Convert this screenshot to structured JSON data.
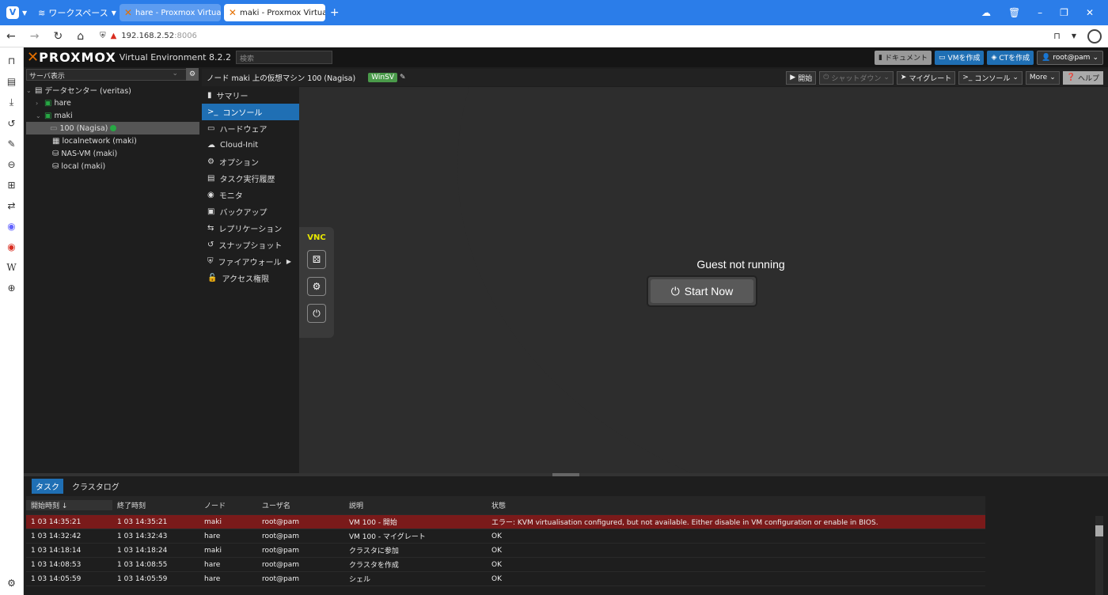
{
  "browser": {
    "workspace": "ワークスペース",
    "tabs": [
      {
        "title": "hare - Proxmox Virtual Env"
      },
      {
        "title": "maki - Proxmox Virtual Env"
      }
    ],
    "url_host": "192.168.2.52",
    "url_port": ":8006"
  },
  "pve": {
    "brand": "PROXMOX",
    "version": "Virtual Environment 8.2.2",
    "search_placeholder": "検索",
    "header_buttons": {
      "docs": "ドキュメント",
      "create_vm": "VMを作成",
      "create_ct": "CTを作成",
      "user": "root@pam"
    },
    "view_selector": "サーバ表示",
    "tree": [
      {
        "label": "データセンター (veritas)"
      },
      {
        "label": "hare"
      },
      {
        "label": "maki"
      },
      {
        "label": "100 (Nagisa)"
      },
      {
        "label": "localnetwork (maki)"
      },
      {
        "label": "NAS-VM (maki)"
      },
      {
        "label": "local (maki)"
      }
    ],
    "content_title": "ノード maki 上の仮想マシン 100 (Nagisa)",
    "tag": "WinSV",
    "toolbar": {
      "start": "開始",
      "shutdown": "シャットダウン",
      "migrate": "マイグレート",
      "console": "コンソール",
      "more": "More",
      "help": "ヘルプ"
    },
    "menu": [
      {
        "label": "サマリー"
      },
      {
        "label": "コンソール"
      },
      {
        "label": "ハードウェア"
      },
      {
        "label": "Cloud-Init"
      },
      {
        "label": "オプション"
      },
      {
        "label": "タスク実行履歴"
      },
      {
        "label": "モニタ"
      },
      {
        "label": "バックアップ"
      },
      {
        "label": "レプリケーション"
      },
      {
        "label": "スナップショット"
      },
      {
        "label": "ファイアウォール"
      },
      {
        "label": "アクセス権限"
      }
    ],
    "console": {
      "vnc_label": "VNC",
      "guest_status": "Guest not running",
      "start_now": "Start Now"
    },
    "bottom": {
      "tabs": [
        "タスク",
        "クラスタログ"
      ],
      "columns": [
        "開始時刻 ↓",
        "終了時刻",
        "ノード",
        "ユーザ名",
        "説明",
        "状態"
      ],
      "rows": [
        {
          "start": "1 03 14:35:21",
          "end": "1 03 14:35:21",
          "node": "maki",
          "user": "root@pam",
          "desc": "VM 100 - 開始",
          "status": "エラー: KVM virtualisation configured, but not available. Either disable in VM configuration or enable in BIOS."
        },
        {
          "start": "1 03 14:32:42",
          "end": "1 03 14:32:43",
          "node": "hare",
          "user": "root@pam",
          "desc": "VM 100 - マイグレート",
          "status": "OK"
        },
        {
          "start": "1 03 14:18:14",
          "end": "1 03 14:18:24",
          "node": "maki",
          "user": "root@pam",
          "desc": "クラスタに参加",
          "status": "OK"
        },
        {
          "start": "1 03 14:08:53",
          "end": "1 03 14:08:55",
          "node": "hare",
          "user": "root@pam",
          "desc": "クラスタを作成",
          "status": "OK"
        },
        {
          "start": "1 03 14:05:59",
          "end": "1 03 14:05:59",
          "node": "hare",
          "user": "root@pam",
          "desc": "シェル",
          "status": "OK"
        }
      ]
    }
  }
}
